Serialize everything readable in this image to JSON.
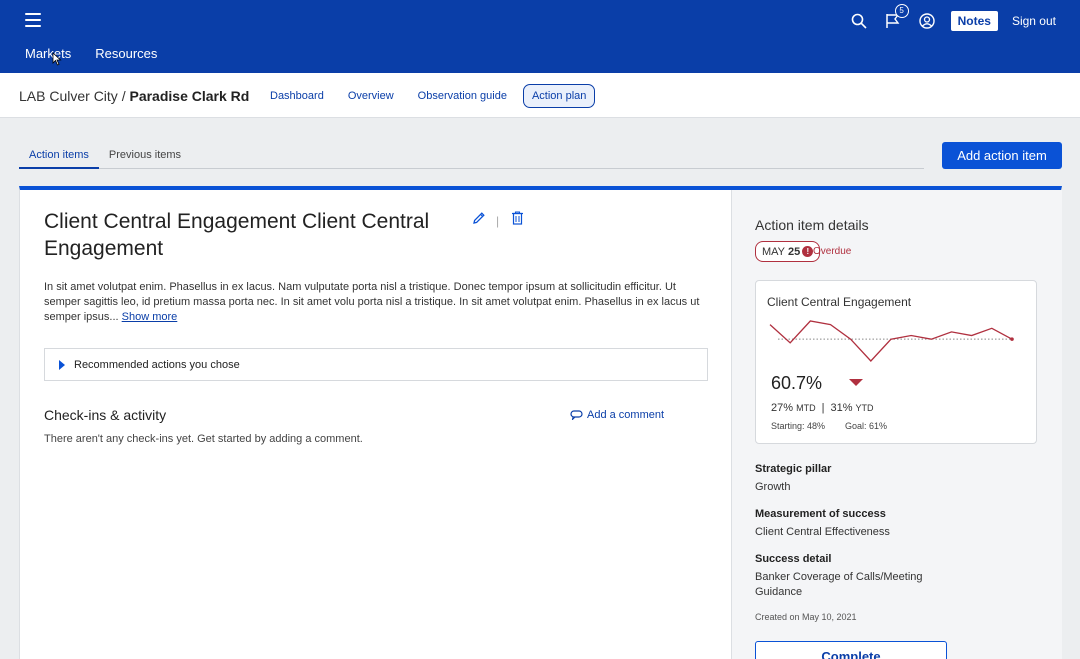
{
  "header": {
    "nav": [
      "Markets",
      "Resources"
    ],
    "notifications_count": "5",
    "notes_label": "Notes",
    "signout_label": "Sign out"
  },
  "subheader": {
    "breadcrumb_parent": "LAB Culver City / ",
    "breadcrumb_current": "Paradise Clark Rd",
    "tabs": [
      "Dashboard",
      "Overview",
      "Observation guide",
      "Action plan"
    ],
    "active_tab": "Action plan"
  },
  "content_tabs": {
    "items": [
      "Action items",
      "Previous items"
    ],
    "active": "Action items",
    "add_button": "Add action item"
  },
  "action_item": {
    "title": "Client Central Engagement Client Central Engagement",
    "description": "In sit amet volutpat enim. Phasellus in ex lacus. Nam vulputate porta nisl a tristique. Donec tempor ipsum at sollicitudin efficitur. Ut semper sagittis leo, id pretium massa porta nec. In sit amet volu porta nisl a tristique. In sit amet volutpat enim. Phasellus in ex lacus ut semper ipsus...",
    "show_more": "Show more",
    "recommended_label": "Recommended actions you chose",
    "checkins_title": "Check-ins & activity",
    "add_comment": "Add a comment",
    "empty_text": "There aren't any check-ins yet. Get started by adding a comment."
  },
  "details": {
    "title": "Action item details",
    "due_month": "MAY",
    "due_day": "25",
    "status": "Overdue",
    "metric": {
      "title": "Client Central Engagement",
      "value": "60.7%",
      "mtd_value": "27%",
      "mtd_label": "MTD",
      "ytd_value": "31%",
      "ytd_label": "YTD",
      "starting": "Starting: 48%",
      "goal": "Goal: 61%",
      "trend": "down",
      "sparkline": [
        62,
        57,
        63,
        62,
        58,
        52,
        58,
        59,
        58,
        60,
        59,
        61,
        58
      ]
    },
    "fields": [
      {
        "label": "Strategic pillar",
        "value": "Growth"
      },
      {
        "label": "Measurement of success",
        "value": "Client Central Effectiveness"
      },
      {
        "label": "Success detail",
        "value": "Banker Coverage of Calls/Meeting Guidance"
      }
    ],
    "created": "Created on May 10, 2021",
    "complete_label": "Complete"
  },
  "colors": {
    "brand": "#0a3ea8",
    "primary_button": "#0a52d6",
    "overdue": "#b0303f"
  }
}
